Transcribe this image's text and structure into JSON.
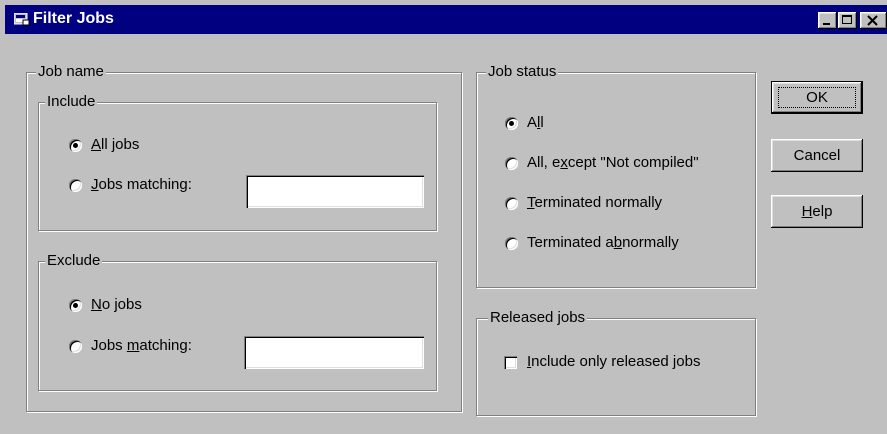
{
  "window": {
    "title": "Filter Jobs",
    "app_icon": "window-app-icon",
    "controls": {
      "minimize": "minimize-icon",
      "maximize": "maximize-icon",
      "close": "close-icon"
    }
  },
  "job_name": {
    "legend": "Job name",
    "include": {
      "legend": "Include",
      "options": [
        {
          "pre": "",
          "key": "A",
          "post": "ll jobs",
          "selected": true
        },
        {
          "pre": "",
          "key": "J",
          "post": "obs matching:",
          "selected": false
        }
      ],
      "field_value": ""
    },
    "exclude": {
      "legend": "Exclude",
      "options": [
        {
          "pre": "",
          "key": "N",
          "post": "o jobs",
          "selected": true
        },
        {
          "pre": "Jobs ",
          "key": "m",
          "post": "atching:",
          "selected": false
        }
      ],
      "field_value": ""
    }
  },
  "job_status": {
    "legend": "Job status",
    "options": [
      {
        "pre": "A",
        "key": "l",
        "post": "l",
        "selected": true
      },
      {
        "pre": "All, e",
        "key": "x",
        "post": "cept \"Not compiled\"",
        "selected": false
      },
      {
        "pre": "",
        "key": "T",
        "post": "erminated normally",
        "selected": false
      },
      {
        "pre": "Terminated a",
        "key": "b",
        "post": "normally",
        "selected": false
      }
    ]
  },
  "released_jobs": {
    "legend": "Released jobs",
    "checkbox": {
      "pre": "",
      "key": "I",
      "post": "nclude only released jobs",
      "checked": false
    }
  },
  "buttons": {
    "ok": "OK",
    "cancel": "Cancel",
    "help": {
      "pre": "",
      "key": "H",
      "post": "elp"
    }
  }
}
